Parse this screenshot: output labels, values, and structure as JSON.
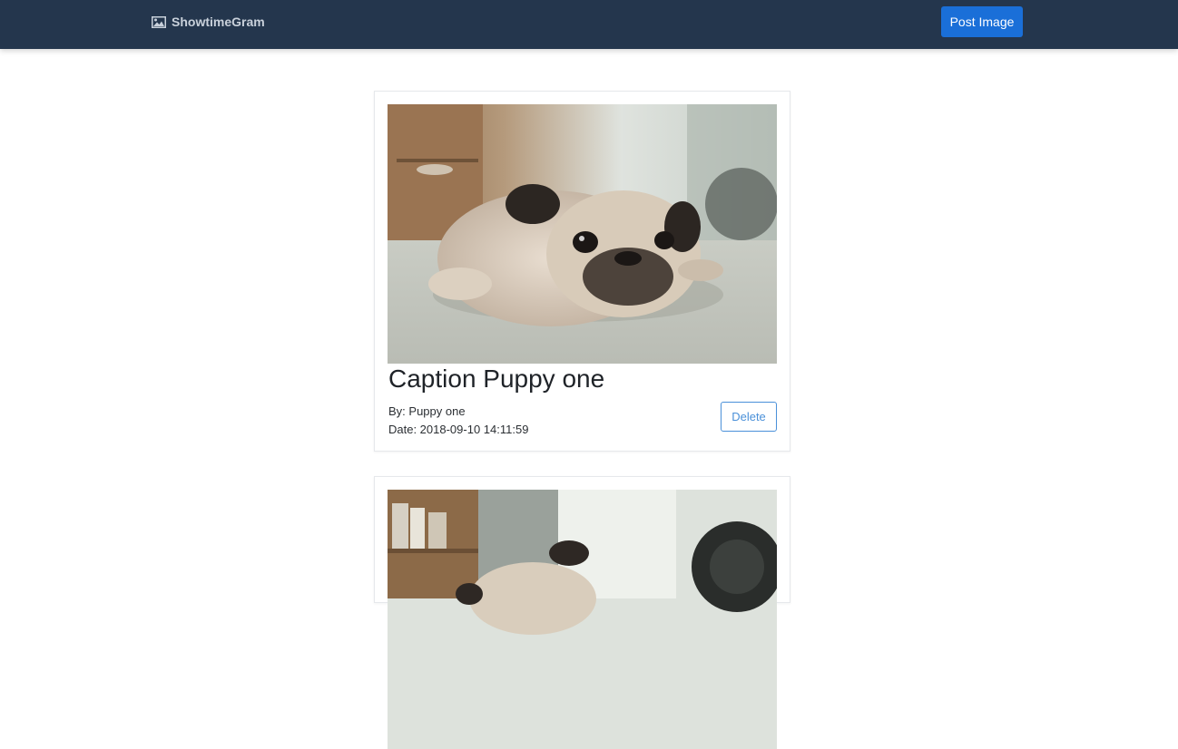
{
  "navbar": {
    "brand_label": "ShowtimeGram",
    "brand_icon": "image-icon",
    "post_button_label": "Post Image",
    "colors": {
      "background": "#24364d",
      "post_button": "#1a6fd8"
    }
  },
  "posts": [
    {
      "caption": "Caption Puppy one",
      "by": "By: Puppy one",
      "date": "Date: 2018-09-10 14:11:59",
      "delete_label": "Delete",
      "image": "pug lying on floor"
    },
    {
      "image": "pug in room with shelves"
    }
  ]
}
